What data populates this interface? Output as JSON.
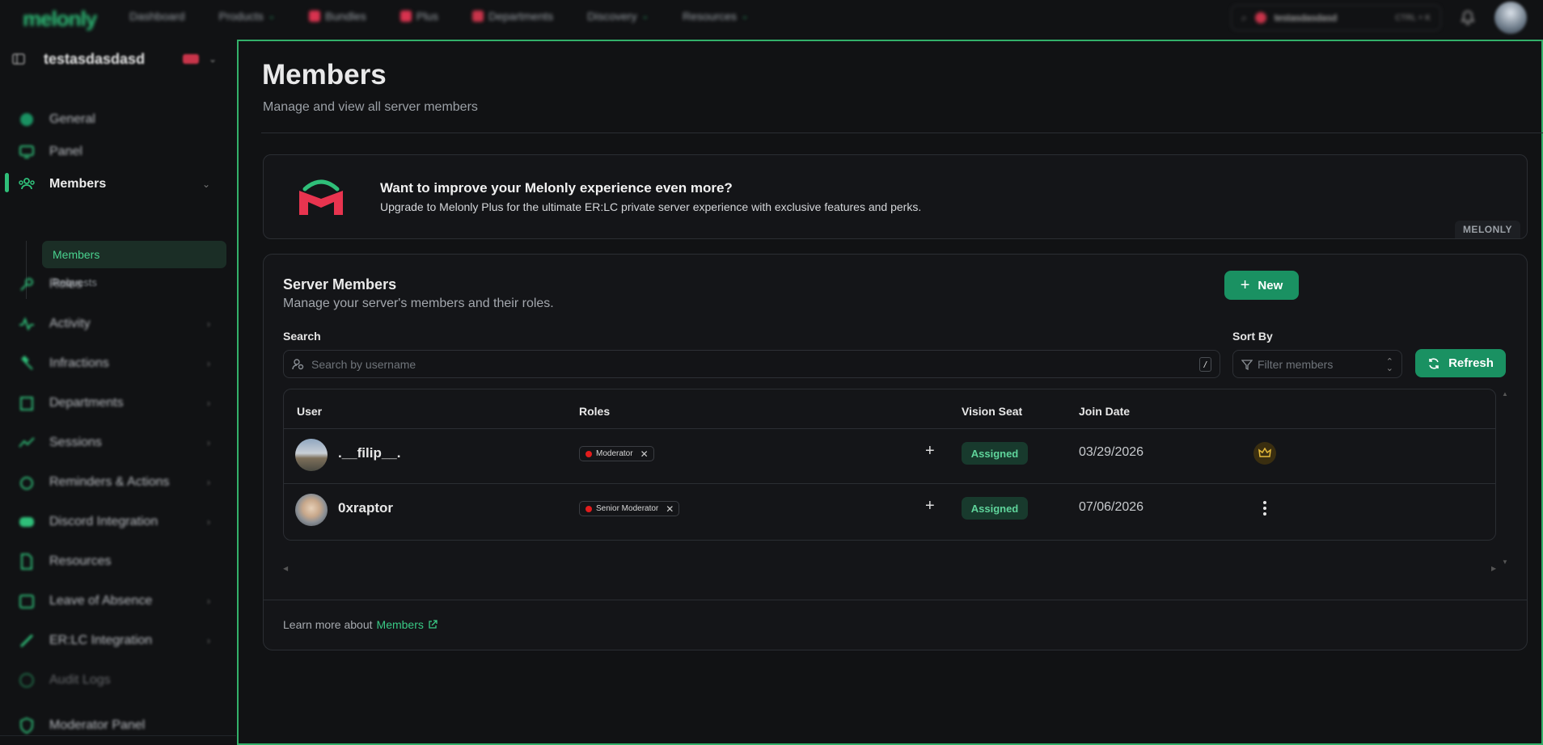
{
  "topbar": {
    "logo": "melonly",
    "nav": [
      "Dashboard",
      "Products",
      "Bundles",
      "Plus",
      "Departments",
      "Discovery",
      "Resources"
    ],
    "search_text": "testasdasdasd",
    "search_shortcut": "CTRL + K"
  },
  "sidebar": {
    "server_name": "testasdasdasd",
    "items": [
      {
        "label": "General",
        "icon": "globe-icon"
      },
      {
        "label": "Panel",
        "icon": "monitor-icon"
      },
      {
        "label": "Members",
        "icon": "users-icon"
      },
      {
        "label": "Roles",
        "icon": "key-icon"
      },
      {
        "label": "Activity",
        "icon": "activity-icon"
      },
      {
        "label": "Infractions",
        "icon": "gavel-icon"
      },
      {
        "label": "Departments",
        "icon": "building-icon"
      },
      {
        "label": "Sessions",
        "icon": "trend-icon"
      },
      {
        "label": "Reminders & Actions",
        "icon": "alarm-icon"
      },
      {
        "label": "Discord Integration",
        "icon": "discord-icon"
      },
      {
        "label": "Resources",
        "icon": "file-icon"
      },
      {
        "label": "Leave of Absence",
        "icon": "calendar-icon"
      },
      {
        "label": "ER:LC Integration",
        "icon": "link-icon"
      },
      {
        "label": "Audit Logs",
        "icon": "clock-icon"
      },
      {
        "label": "Moderator Panel",
        "icon": "shield-icon"
      }
    ],
    "sub_items": [
      "Members",
      "Requests"
    ]
  },
  "header": {
    "title": "Members",
    "subtitle": "Manage and view all server members"
  },
  "promo": {
    "title": "Want to improve your Melonly experience even more?",
    "text": "Upgrade to Melonly Plus for the ultimate ER:LC private server experience with exclusive features and perks.",
    "badge": "MELONLY"
  },
  "panel": {
    "title": "Server Members",
    "subtitle": "Manage your server's members and their roles.",
    "new_label": "New",
    "search_label": "Search",
    "search_placeholder": "Search by username",
    "search_kbd": "/",
    "sort_label": "Sort By",
    "sort_placeholder": "Filter members",
    "refresh_label": "Refresh",
    "columns": [
      "User",
      "Roles",
      "Vision Seat",
      "Join Date"
    ],
    "rows": [
      {
        "user": ".__filip__.",
        "role": "Moderator",
        "seat": "Assigned",
        "date": "03/29/2026"
      },
      {
        "user": "0xraptor",
        "role": "Senior Moderator",
        "seat": "Assigned",
        "date": "07/06/2026"
      }
    ],
    "learn_prefix": "Learn more about",
    "learn_link": "Members"
  },
  "colors": {
    "accent": "#2fbf79",
    "button": "#1a9162",
    "role_dot": "#e21c1c",
    "outline": "#33b06a"
  }
}
